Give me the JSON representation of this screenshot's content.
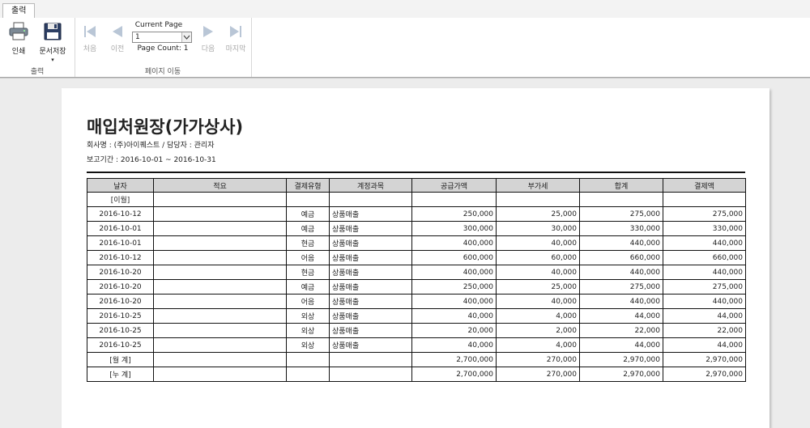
{
  "tab": {
    "label": "출력"
  },
  "ribbon": {
    "print_label": "인쇄",
    "save_label": "문서저장",
    "save_dropdown": "▾",
    "output_group": "출력",
    "first_label": "처음",
    "prev_label": "이전",
    "current_page_label": "Current Page",
    "current_page_value": "1",
    "page_count_label": "Page Count: 1",
    "next_label": "다음",
    "last_label": "마지막",
    "nav_group": "페이지 이동"
  },
  "report": {
    "title": "매입처원장(가가상사)",
    "company": "회사명 : (주)아이퀘스트 / 담당자 : 관리자",
    "period": "보고기간 :  2016-10-01 ~ 2016-10-31",
    "columns": [
      "날자",
      "적요",
      "결제유형",
      "계정과목",
      "공급가액",
      "부가세",
      "합계",
      "결제액"
    ],
    "rows": [
      [
        "[이월]",
        "",
        "",
        "",
        "",
        "",
        "",
        ""
      ],
      [
        "2016-10-12",
        "",
        "예금",
        "상품매출",
        "250,000",
        "25,000",
        "275,000",
        "275,000"
      ],
      [
        "2016-10-01",
        "",
        "예금",
        "상품매출",
        "300,000",
        "30,000",
        "330,000",
        "330,000"
      ],
      [
        "2016-10-01",
        "",
        "현금",
        "상품매출",
        "400,000",
        "40,000",
        "440,000",
        "440,000"
      ],
      [
        "2016-10-12",
        "",
        "어음",
        "상품매출",
        "600,000",
        "60,000",
        "660,000",
        "660,000"
      ],
      [
        "2016-10-20",
        "",
        "현금",
        "상품매출",
        "400,000",
        "40,000",
        "440,000",
        "440,000"
      ],
      [
        "2016-10-20",
        "",
        "예금",
        "상품매출",
        "250,000",
        "25,000",
        "275,000",
        "275,000"
      ],
      [
        "2016-10-20",
        "",
        "어음",
        "상품매출",
        "400,000",
        "40,000",
        "440,000",
        "440,000"
      ],
      [
        "2016-10-25",
        "",
        "외상",
        "상품매출",
        "40,000",
        "4,000",
        "44,000",
        "44,000"
      ],
      [
        "2016-10-25",
        "",
        "외상",
        "상품매출",
        "20,000",
        "2,000",
        "22,000",
        "22,000"
      ],
      [
        "2016-10-25",
        "",
        "외상",
        "상품매출",
        "40,000",
        "4,000",
        "44,000",
        "44,000"
      ],
      [
        "[월  계]",
        "",
        "",
        "",
        "2,700,000",
        "270,000",
        "2,970,000",
        "2,970,000"
      ],
      [
        "[누  계]",
        "",
        "",
        "",
        "2,700,000",
        "270,000",
        "2,970,000",
        "2,970,000"
      ]
    ]
  }
}
